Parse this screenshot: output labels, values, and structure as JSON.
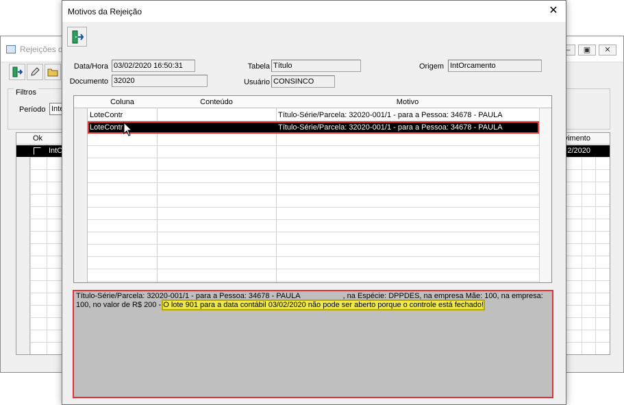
{
  "background_window": {
    "title": "Rejeições d",
    "filters_legend": "Filtros",
    "period_label": "Período",
    "period_value": "Inte",
    "grid": {
      "col_ok": "Ok",
      "col_venc": "vimento",
      "selected_row": {
        "col1": "IntO",
        "col2": "2/2020"
      }
    }
  },
  "dialog": {
    "title": "Motivos da Rejeição",
    "fields": {
      "datahora_label": "Data/Hora",
      "datahora_value": "03/02/2020  16:50:31",
      "tabela_label": "Tabela",
      "tabela_value": "Título",
      "origem_label": "Origem",
      "origem_value": "IntOrcamento",
      "documento_label": "Documento",
      "documento_value": "32020",
      "usuario_label": "Usuário",
      "usuario_value": "CONSINCO"
    },
    "grid": {
      "columns": [
        "Coluna",
        "Conteúdo",
        "Motivo"
      ],
      "rows": [
        {
          "coluna": "LoteContr",
          "conteudo": "",
          "motivo": "Título-Série/Parcela: 32020-001/1 - para a Pessoa: 34678 - PAULA",
          "selected": false
        },
        {
          "coluna": "LoteContr",
          "conteudo": "",
          "motivo": "Título-Série/Parcela: 32020-001/1 - para a Pessoa: 34678 - PAULA",
          "selected": true
        }
      ]
    },
    "message": {
      "part1": "Título-Série/Parcela: 32020-001/1 - para a Pessoa: 34678 - PAULA",
      "part2": ", na Espécie: DPPDES, na empresa Mãe: 100, na empresa: 100, no valor de R$ 200 -",
      "highlight": "O lote 901 para a data contábil 03/02/2020 não pode ser aberto porque o controle está fechado!"
    }
  }
}
